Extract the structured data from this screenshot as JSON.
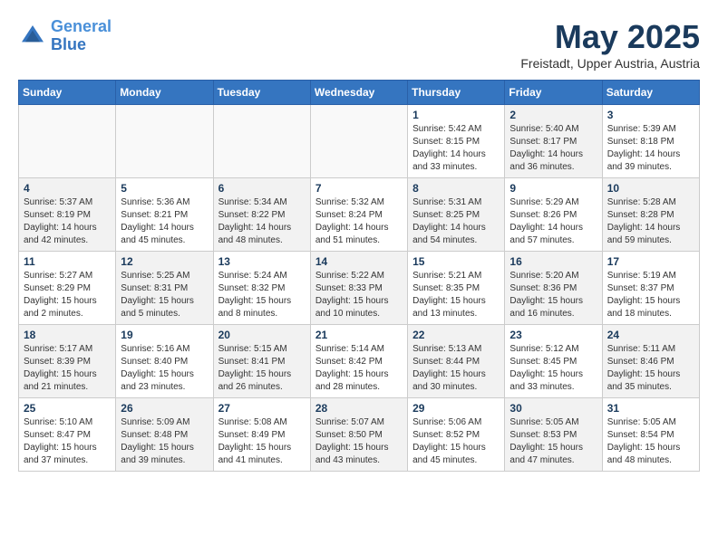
{
  "header": {
    "logo_line1": "General",
    "logo_line2": "Blue",
    "month": "May 2025",
    "location": "Freistadt, Upper Austria, Austria"
  },
  "days_of_week": [
    "Sunday",
    "Monday",
    "Tuesday",
    "Wednesday",
    "Thursday",
    "Friday",
    "Saturday"
  ],
  "weeks": [
    [
      {
        "day": "",
        "content": "",
        "empty": true
      },
      {
        "day": "",
        "content": "",
        "empty": true
      },
      {
        "day": "",
        "content": "",
        "empty": true
      },
      {
        "day": "",
        "content": "",
        "empty": true
      },
      {
        "day": "1",
        "content": "Sunrise: 5:42 AM\nSunset: 8:15 PM\nDaylight: 14 hours\nand 33 minutes.",
        "shaded": false
      },
      {
        "day": "2",
        "content": "Sunrise: 5:40 AM\nSunset: 8:17 PM\nDaylight: 14 hours\nand 36 minutes.",
        "shaded": true
      },
      {
        "day": "3",
        "content": "Sunrise: 5:39 AM\nSunset: 8:18 PM\nDaylight: 14 hours\nand 39 minutes.",
        "shaded": false
      }
    ],
    [
      {
        "day": "4",
        "content": "Sunrise: 5:37 AM\nSunset: 8:19 PM\nDaylight: 14 hours\nand 42 minutes.",
        "shaded": true
      },
      {
        "day": "5",
        "content": "Sunrise: 5:36 AM\nSunset: 8:21 PM\nDaylight: 14 hours\nand 45 minutes.",
        "shaded": false
      },
      {
        "day": "6",
        "content": "Sunrise: 5:34 AM\nSunset: 8:22 PM\nDaylight: 14 hours\nand 48 minutes.",
        "shaded": true
      },
      {
        "day": "7",
        "content": "Sunrise: 5:32 AM\nSunset: 8:24 PM\nDaylight: 14 hours\nand 51 minutes.",
        "shaded": false
      },
      {
        "day": "8",
        "content": "Sunrise: 5:31 AM\nSunset: 8:25 PM\nDaylight: 14 hours\nand 54 minutes.",
        "shaded": true
      },
      {
        "day": "9",
        "content": "Sunrise: 5:29 AM\nSunset: 8:26 PM\nDaylight: 14 hours\nand 57 minutes.",
        "shaded": false
      },
      {
        "day": "10",
        "content": "Sunrise: 5:28 AM\nSunset: 8:28 PM\nDaylight: 14 hours\nand 59 minutes.",
        "shaded": true
      }
    ],
    [
      {
        "day": "11",
        "content": "Sunrise: 5:27 AM\nSunset: 8:29 PM\nDaylight: 15 hours\nand 2 minutes.",
        "shaded": false
      },
      {
        "day": "12",
        "content": "Sunrise: 5:25 AM\nSunset: 8:31 PM\nDaylight: 15 hours\nand 5 minutes.",
        "shaded": true
      },
      {
        "day": "13",
        "content": "Sunrise: 5:24 AM\nSunset: 8:32 PM\nDaylight: 15 hours\nand 8 minutes.",
        "shaded": false
      },
      {
        "day": "14",
        "content": "Sunrise: 5:22 AM\nSunset: 8:33 PM\nDaylight: 15 hours\nand 10 minutes.",
        "shaded": true
      },
      {
        "day": "15",
        "content": "Sunrise: 5:21 AM\nSunset: 8:35 PM\nDaylight: 15 hours\nand 13 minutes.",
        "shaded": false
      },
      {
        "day": "16",
        "content": "Sunrise: 5:20 AM\nSunset: 8:36 PM\nDaylight: 15 hours\nand 16 minutes.",
        "shaded": true
      },
      {
        "day": "17",
        "content": "Sunrise: 5:19 AM\nSunset: 8:37 PM\nDaylight: 15 hours\nand 18 minutes.",
        "shaded": false
      }
    ],
    [
      {
        "day": "18",
        "content": "Sunrise: 5:17 AM\nSunset: 8:39 PM\nDaylight: 15 hours\nand 21 minutes.",
        "shaded": true
      },
      {
        "day": "19",
        "content": "Sunrise: 5:16 AM\nSunset: 8:40 PM\nDaylight: 15 hours\nand 23 minutes.",
        "shaded": false
      },
      {
        "day": "20",
        "content": "Sunrise: 5:15 AM\nSunset: 8:41 PM\nDaylight: 15 hours\nand 26 minutes.",
        "shaded": true
      },
      {
        "day": "21",
        "content": "Sunrise: 5:14 AM\nSunset: 8:42 PM\nDaylight: 15 hours\nand 28 minutes.",
        "shaded": false
      },
      {
        "day": "22",
        "content": "Sunrise: 5:13 AM\nSunset: 8:44 PM\nDaylight: 15 hours\nand 30 minutes.",
        "shaded": true
      },
      {
        "day": "23",
        "content": "Sunrise: 5:12 AM\nSunset: 8:45 PM\nDaylight: 15 hours\nand 33 minutes.",
        "shaded": false
      },
      {
        "day": "24",
        "content": "Sunrise: 5:11 AM\nSunset: 8:46 PM\nDaylight: 15 hours\nand 35 minutes.",
        "shaded": true
      }
    ],
    [
      {
        "day": "25",
        "content": "Sunrise: 5:10 AM\nSunset: 8:47 PM\nDaylight: 15 hours\nand 37 minutes.",
        "shaded": false
      },
      {
        "day": "26",
        "content": "Sunrise: 5:09 AM\nSunset: 8:48 PM\nDaylight: 15 hours\nand 39 minutes.",
        "shaded": true
      },
      {
        "day": "27",
        "content": "Sunrise: 5:08 AM\nSunset: 8:49 PM\nDaylight: 15 hours\nand 41 minutes.",
        "shaded": false
      },
      {
        "day": "28",
        "content": "Sunrise: 5:07 AM\nSunset: 8:50 PM\nDaylight: 15 hours\nand 43 minutes.",
        "shaded": true
      },
      {
        "day": "29",
        "content": "Sunrise: 5:06 AM\nSunset: 8:52 PM\nDaylight: 15 hours\nand 45 minutes.",
        "shaded": false
      },
      {
        "day": "30",
        "content": "Sunrise: 5:05 AM\nSunset: 8:53 PM\nDaylight: 15 hours\nand 47 minutes.",
        "shaded": true
      },
      {
        "day": "31",
        "content": "Sunrise: 5:05 AM\nSunset: 8:54 PM\nDaylight: 15 hours\nand 48 minutes.",
        "shaded": false
      }
    ]
  ]
}
